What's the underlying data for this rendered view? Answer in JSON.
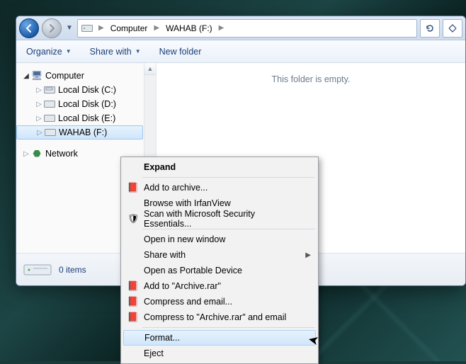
{
  "breadcrumb": {
    "root_icon": "computer-icon",
    "items": [
      "Computer",
      "WAHAB (F:)"
    ]
  },
  "toolbar": {
    "organize": "Organize",
    "share_with": "Share with",
    "new_folder": "New folder"
  },
  "tree": {
    "computer": {
      "label": "Computer",
      "children": [
        {
          "label": "Local Disk (C:)"
        },
        {
          "label": "Local Disk (D:)"
        },
        {
          "label": "Local Disk (E:)"
        },
        {
          "label": "WAHAB (F:)",
          "selected": true
        }
      ]
    },
    "network": {
      "label": "Network"
    }
  },
  "content": {
    "empty_text": "This folder is empty."
  },
  "status": {
    "item_count_text": "0 items"
  },
  "context_menu": {
    "items": [
      {
        "label": "Expand",
        "bold": true
      },
      {
        "sep": true
      },
      {
        "label": "Add to archive...",
        "icon": "rar-icon"
      },
      {
        "label": "Browse with IrfanView"
      },
      {
        "label": "Scan with Microsoft Security Essentials...",
        "icon": "shield-icon"
      },
      {
        "sep": true
      },
      {
        "label": "Open in new window"
      },
      {
        "label": "Share with",
        "submenu": true
      },
      {
        "label": "Open as Portable Device"
      },
      {
        "label": "Add to \"Archive.rar\"",
        "icon": "rar-icon"
      },
      {
        "label": "Compress and email...",
        "icon": "rar-icon"
      },
      {
        "label": "Compress to \"Archive.rar\" and email",
        "icon": "rar-icon"
      },
      {
        "sep": true
      },
      {
        "label": "Format...",
        "hover": true
      },
      {
        "label": "Eject"
      }
    ]
  }
}
